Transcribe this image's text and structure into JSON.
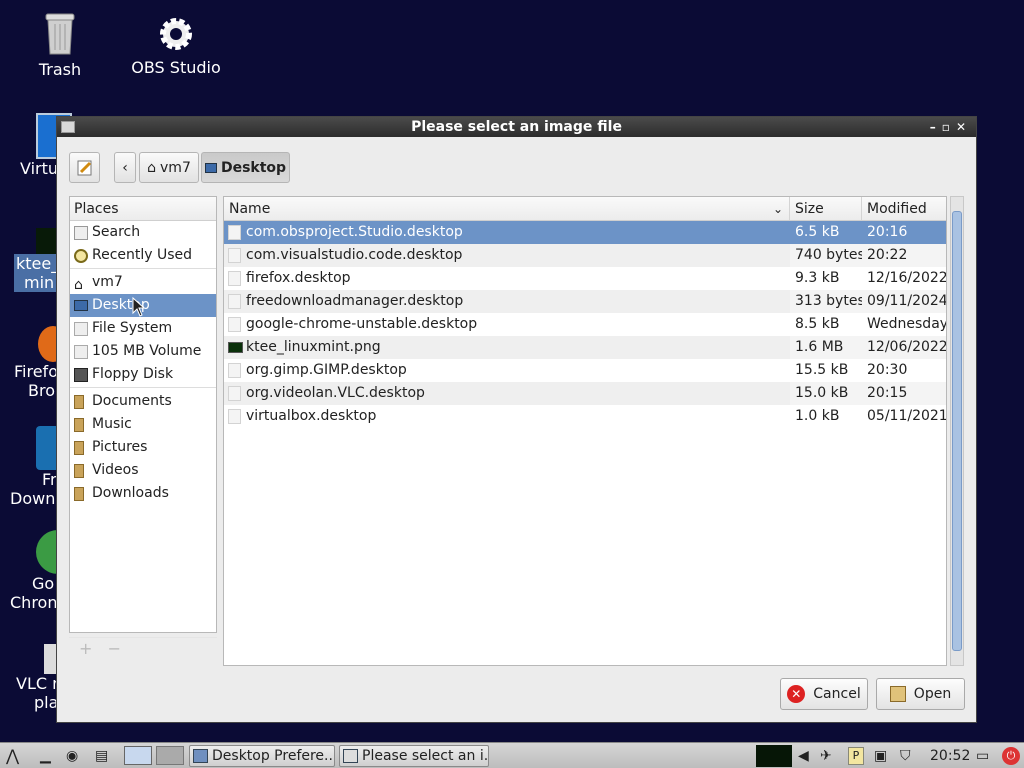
{
  "desktop": {
    "icons": [
      {
        "label": "Trash",
        "icon": "trash-icon"
      },
      {
        "label": "OBS Studio",
        "icon": "gear-icon"
      },
      {
        "label": "Virtu",
        "icon": "virtualbox-icon"
      },
      {
        "label": "ktee_",
        "label2": "min",
        "icon": "image-icon"
      },
      {
        "label": "Firefo",
        "label2": "Bro",
        "icon": "firefox-icon"
      },
      {
        "label": "Fr",
        "label2": "Down",
        "icon": "fdm-icon"
      },
      {
        "label": "Go",
        "label2": "Chron",
        "icon": "chrome-icon"
      },
      {
        "label": "VLC r",
        "label2": "pla",
        "icon": "vlc-icon"
      }
    ]
  },
  "dialog": {
    "title": "Please select an image file",
    "breadcrumb": [
      "vm7",
      "Desktop"
    ],
    "places_header": "Places",
    "places_group1": [
      "Search",
      "Recently Used"
    ],
    "places_group2": [
      "vm7",
      "Desktop",
      "File System",
      "105 MB Volume",
      "Floppy Disk"
    ],
    "places_group3": [
      "Documents",
      "Music",
      "Pictures",
      "Videos",
      "Downloads"
    ],
    "selected_place": "Desktop",
    "columns": {
      "name": "Name",
      "size": "Size",
      "modified": "Modified"
    },
    "files": [
      {
        "name": "com.obsproject.Studio.desktop",
        "size": "6.5 kB",
        "modified": "20:16",
        "selected": true
      },
      {
        "name": "com.visualstudio.code.desktop",
        "size": "740 bytes",
        "modified": "20:22"
      },
      {
        "name": "firefox.desktop",
        "size": "9.3 kB",
        "modified": "12/16/2022"
      },
      {
        "name": "freedownloadmanager.desktop",
        "size": "313 bytes",
        "modified": "09/11/2024"
      },
      {
        "name": "google-chrome-unstable.desktop",
        "size": "8.5 kB",
        "modified": "Wednesday"
      },
      {
        "name": "ktee_linuxmint.png",
        "size": "1.6 MB",
        "modified": "12/06/2022",
        "image": true
      },
      {
        "name": "org.gimp.GIMP.desktop",
        "size": "15.5 kB",
        "modified": "20:30"
      },
      {
        "name": "org.videolan.VLC.desktop",
        "size": "15.0 kB",
        "modified": "20:15"
      },
      {
        "name": "virtualbox.desktop",
        "size": "1.0 kB",
        "modified": "05/11/2021"
      }
    ],
    "cancel_label": "Cancel",
    "open_label": "Open"
  },
  "taskbar": {
    "tasks": [
      "Desktop Prefere...",
      "Please select an i..."
    ],
    "clock": "20:52"
  },
  "colors": {
    "desktop_bg": "#0b0b35",
    "selection": "#6c93c7"
  }
}
